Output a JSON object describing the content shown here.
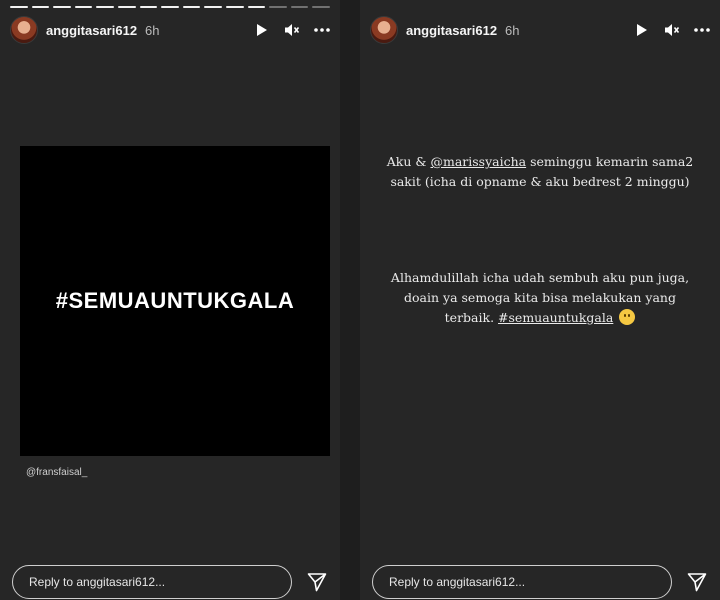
{
  "left_story": {
    "progress": {
      "total": 15,
      "done": 12
    },
    "username": "anggitasari612",
    "time": "6h",
    "hashtag": "#SEMUAUNTUKGALA",
    "credit": "@fransfaisal_",
    "reply_placeholder": "Reply to anggitasari612..."
  },
  "right_story": {
    "username": "anggitasari612",
    "time": "6h",
    "para1_prefix": "Aku & ",
    "mention": "@marissyaicha",
    "para1_rest": " seminggu kemarin sama2 sakit (icha di opname & aku bedrest 2 minggu)",
    "para2_text": "Alhamdulillah icha udah sembuh aku pun juga, doain ya semoga kita bisa melakukan yang terbaik. ",
    "tag": "#semuauntukgala",
    "emoji": "slightly-smiling-face",
    "reply_placeholder": "Reply to anggitasari612..."
  },
  "icons": [
    "play-icon",
    "mute-icon",
    "more-icon",
    "send-icon"
  ],
  "colors": {
    "background": "#262626",
    "image_bg": "#000000",
    "text": "#ffffff"
  }
}
